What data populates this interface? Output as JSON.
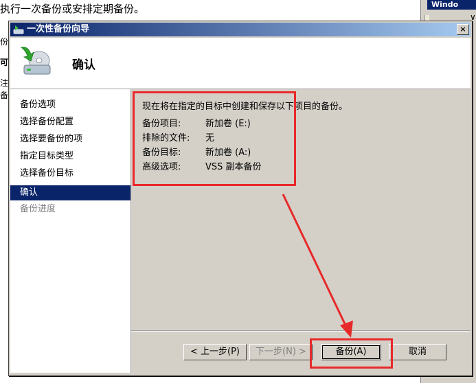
{
  "background": {
    "instruction_text": "执行一次备份或安排定期备份。",
    "left_fragments": [
      "份",
      "可",
      "注",
      "备"
    ],
    "right_title": "Windo",
    "right_fragments": [
      "∨",
      "ì"
    ]
  },
  "dialog": {
    "title": "一次性备份向导",
    "close_label": "×",
    "header_title": "确认"
  },
  "nav": {
    "items": [
      {
        "label": "备份选项",
        "state": "normal"
      },
      {
        "label": "选择备份配置",
        "state": "normal"
      },
      {
        "label": "选择要备份的项",
        "state": "normal"
      },
      {
        "label": "指定目标类型",
        "state": "normal"
      },
      {
        "label": "选择备份目标",
        "state": "normal"
      },
      {
        "label": "确认",
        "state": "active"
      },
      {
        "label": "备份进度",
        "state": "disabled"
      }
    ]
  },
  "summary": {
    "intro": "现在将在指定的目标中创建和保存以下项目的备份。",
    "rows": [
      {
        "label": "备份项目:",
        "value": "新加卷 (E:)"
      },
      {
        "label": "排除的文件:",
        "value": "无"
      },
      {
        "label": "备份目标:",
        "value": "新加卷 (A:)"
      },
      {
        "label": "高级选项:",
        "value": "VSS 副本备份"
      }
    ]
  },
  "buttons": {
    "back": "< 上一步(P)",
    "next": "下一步(N) >",
    "backup": "备份(A)",
    "cancel": "取消"
  },
  "colors": {
    "highlight": "#e8292a",
    "title_bar": "#0a246a",
    "selection": "#0a246a"
  }
}
